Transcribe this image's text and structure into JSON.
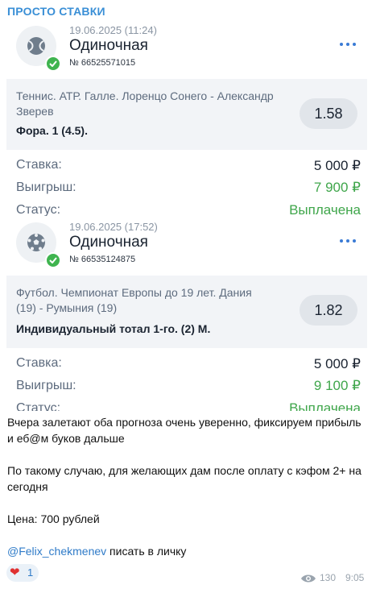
{
  "channel_name": "ПРОСТО СТАВКИ",
  "bets": [
    {
      "date": "19.06.2025 (11:24)",
      "type": "Одиночная",
      "number": "№ 66525571015",
      "sport_icon": "tennis-ball-icon",
      "event": "Теннис. АТР. Галле. Лоренцо Сонего - Александр Зверев",
      "market": "Фора. 1 (4.5).",
      "odds": "1.58",
      "stake_label": "Ставка:",
      "stake": "5 000 ₽",
      "win_label": "Выигрыш:",
      "win": "7 900 ₽",
      "status_label": "Статус:",
      "status": "Выплачена"
    },
    {
      "date": "19.06.2025 (17:52)",
      "type": "Одиночная",
      "number": "№ 66535124875",
      "sport_icon": "soccer-ball-icon",
      "event": "Футбол. Чемпионат Европы до 19 лет. Дания (19) - Румыния (19)",
      "market": "Индивидуальный тотал 1-го. (2) М.",
      "odds": "1.82",
      "stake_label": "Ставка:",
      "stake": "5 000 ₽",
      "win_label": "Выигрыш:",
      "win": "9 100 ₽",
      "status_label": "Статус:",
      "status": "Выплачена"
    }
  ],
  "message": {
    "p1": "Вчера залетают оба прогноза очень уверенно, фиксируем прибыль и еб@м буков дальше",
    "p2": "По такому случаю, для желающих дам после оплату с кэфом 2+ на сегодня",
    "p3": "Цена: 700 рублей",
    "mention": "@Felix_chekmenev",
    "p4_rest": " писать в личку"
  },
  "reaction": {
    "emoji": "❤",
    "count": "1"
  },
  "views": "130",
  "time": "9:05",
  "colors": {
    "accent": "#3a8fd6",
    "win_green": "#3fa64b",
    "check_green": "#3fb44f"
  }
}
